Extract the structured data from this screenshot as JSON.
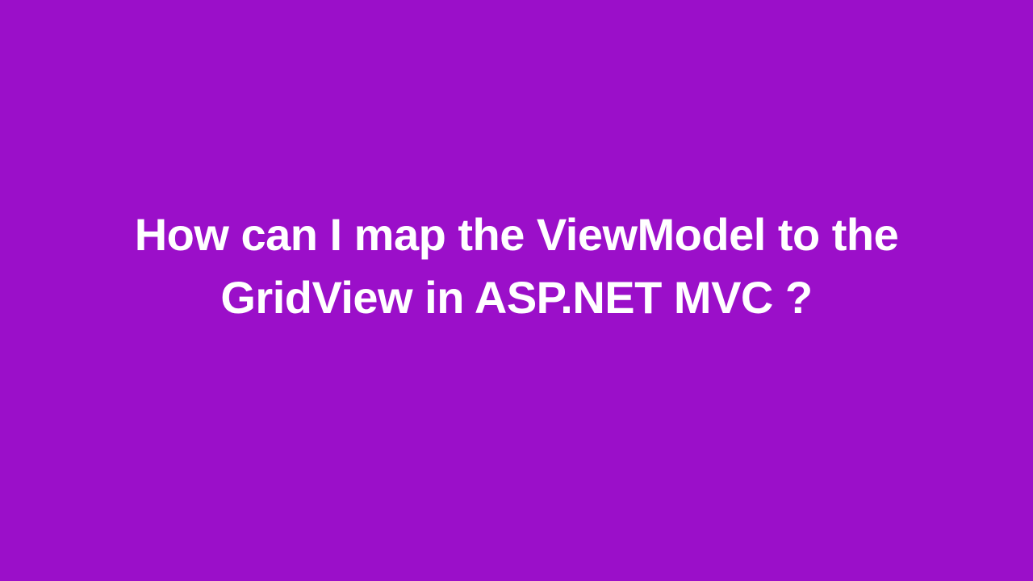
{
  "slide": {
    "heading": "How can I map the ViewModel to the GridView in ASP.NET MVC ?",
    "background_color": "#9b0fc9",
    "text_color": "#ffffff"
  }
}
